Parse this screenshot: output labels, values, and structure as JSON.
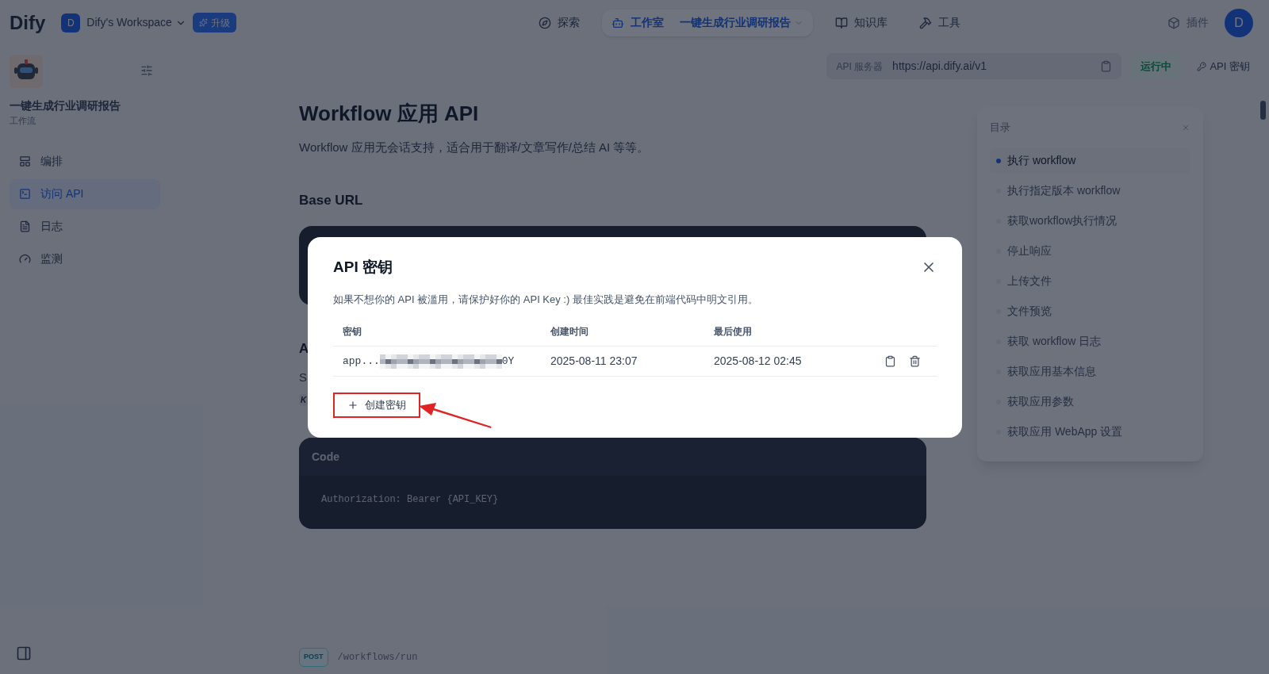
{
  "nav": {
    "logo": "Dify",
    "workspace": {
      "initial": "D",
      "name": "Dify's Workspace"
    },
    "upgrade": "升级",
    "tabs": [
      {
        "label": "探索",
        "selected": false,
        "kind": "explore"
      },
      {
        "label": "工作室",
        "selected": true,
        "kind": "studio"
      },
      {
        "label": "知识库",
        "selected": false,
        "kind": "knowledge"
      },
      {
        "label": "工具",
        "selected": false,
        "kind": "tools"
      }
    ],
    "app_crumb": "一键生成行业调研报告",
    "plugins": "插件",
    "avatar": "D"
  },
  "sidebar": {
    "app_name": "一键生成行业调研报告",
    "app_type": "工作流",
    "items": [
      {
        "label": "编排",
        "selected": false,
        "kind": "orchestrate"
      },
      {
        "label": "访问 API",
        "selected": true,
        "kind": "api"
      },
      {
        "label": "日志",
        "selected": false,
        "kind": "logs"
      },
      {
        "label": "监测",
        "selected": false,
        "kind": "monitor"
      }
    ]
  },
  "api_bar": {
    "label": "API 服务器",
    "url": "https://api.dify.ai/v1",
    "status": "运行中",
    "keys_button": "API 密钥"
  },
  "content": {
    "title": "Workflow 应用 API",
    "intro": "Workflow 应用无会话支持，适合用于翻译/文章写作/总结 AI 等等。",
    "base_url_heading": "Base URL",
    "auth_heading": "A",
    "auth_text": "S",
    "auth_tag": "K",
    "code": {
      "title": "Code",
      "text": "Authorization: Bearer {API_KEY}"
    },
    "endpoint": {
      "method": "POST",
      "path": "/workflows/run"
    }
  },
  "toc": {
    "title": "目录",
    "items": [
      {
        "label": "执行 workflow",
        "selected": true
      },
      {
        "label": "执行指定版本 workflow",
        "selected": false
      },
      {
        "label": "获取workflow执行情况",
        "selected": false
      },
      {
        "label": "停止响应",
        "selected": false
      },
      {
        "label": "上传文件",
        "selected": false
      },
      {
        "label": "文件预览",
        "selected": false
      },
      {
        "label": "获取 workflow 日志",
        "selected": false
      },
      {
        "label": "获取应用基本信息",
        "selected": false
      },
      {
        "label": "获取应用参数",
        "selected": false
      },
      {
        "label": "获取应用 WebApp 设置",
        "selected": false
      }
    ]
  },
  "dialog": {
    "title": "API 密钥",
    "note": "如果不想你的 API 被滥用，请保护好你的 API Key :) 最佳实践是避免在前端代码中明文引用。",
    "columns": [
      "密钥",
      "创建时间",
      "最后使用"
    ],
    "rows": [
      {
        "key_start": "app...",
        "key_end": "0Y",
        "created": "2025-08-11 23:07",
        "last_used": "2025-08-12 02:45"
      }
    ],
    "create_button": "创建密钥"
  }
}
